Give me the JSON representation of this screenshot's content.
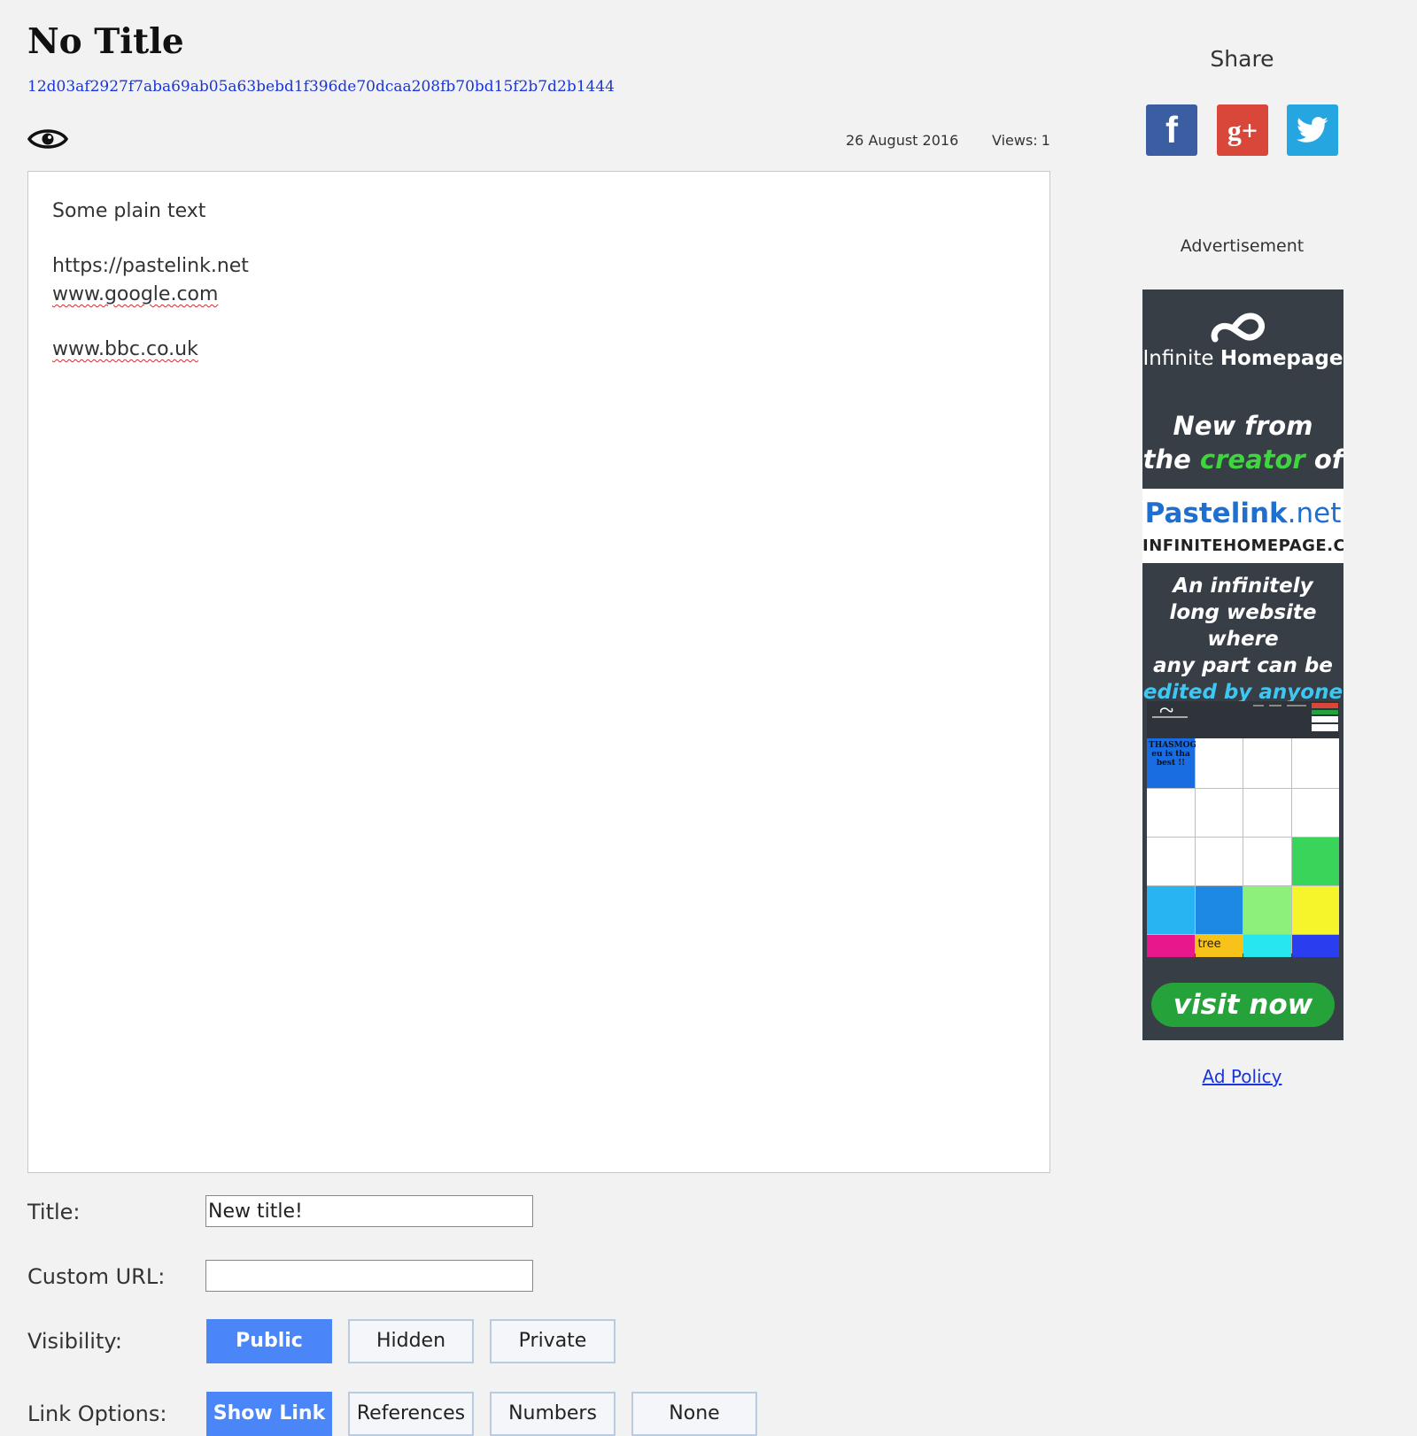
{
  "paste": {
    "title": "No Title",
    "hash": "12d03af2927f7aba69ab05a63bebd1f396de70dcaa208fb70bd15f2b7d2b1444",
    "date": "26 August 2016",
    "views_label": "Views:",
    "views_count": "1",
    "lines": [
      "Some plain text",
      "https://pastelink.net",
      "www.google.com",
      "www.bbc.co.uk"
    ]
  },
  "form": {
    "title_label": "Title:",
    "title_value": "New title!",
    "custom_url_label": "Custom URL:",
    "custom_url_value": "",
    "visibility_label": "Visibility:",
    "visibility_options": [
      "Public",
      "Hidden",
      "Private"
    ],
    "visibility_selected": "Public",
    "link_options_label": "Link Options:",
    "link_options": [
      "Show Link",
      "References",
      "Numbers",
      "None"
    ],
    "link_options_selected": "Show Link"
  },
  "sidebar": {
    "share_label": "Share",
    "share_buttons": [
      {
        "name": "facebook",
        "glyph": "f",
        "color": "#3b5da2"
      },
      {
        "name": "google-plus",
        "glyph": "g+",
        "color": "#d9473b"
      },
      {
        "name": "twitter",
        "color": "#26a6e0"
      }
    ],
    "ad_label": "Advertisement",
    "ad": {
      "brand_light": "Infinite",
      "brand_bold": "Homepage",
      "tagline_1": "New from",
      "tagline_2_pre": "the",
      "tagline_2_accent": "creator",
      "tagline_2_post": "of",
      "pastelink_bold": "Pastelink",
      "pastelink_light": ".net",
      "domain": "INFINITEHOMEPAGE.COM",
      "desc_1": "An infinitely",
      "desc_2": "long website where",
      "desc_3": "any part can be",
      "desc_accent": "edited by anyone",
      "cell_text": "THASMOG eu is tha best !!",
      "tree_text": "tree",
      "cta": "visit now"
    },
    "ad_policy": "Ad Policy"
  },
  "colors": {
    "page_bg": "#f2f2f2",
    "link_blue": "#1a35d8",
    "active_button": "#4a86f7",
    "ad_bg": "#383e46",
    "cta_green": "#26a23a"
  }
}
